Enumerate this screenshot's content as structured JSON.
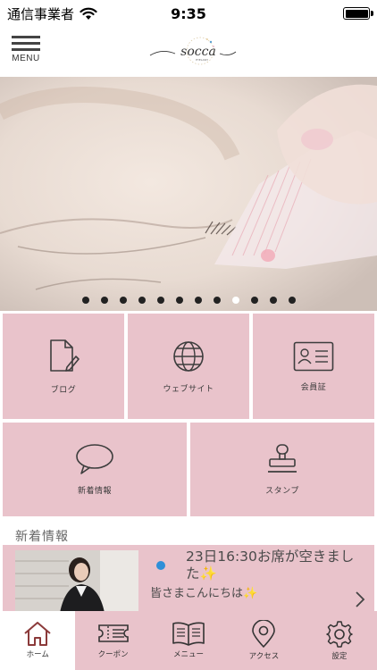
{
  "status_bar": {
    "carrier": "通信事業者",
    "time": "9:35",
    "battery_level": 1.0
  },
  "header": {
    "menu_label": "MENU",
    "logo_text": "socca",
    "logo_subtext": "EYELASH"
  },
  "hero": {
    "slide_count": 12,
    "active_slide": 8
  },
  "tiles": [
    {
      "label": "ブログ",
      "icon": "document-edit-icon"
    },
    {
      "label": "ウェブサイト",
      "icon": "globe-icon"
    },
    {
      "label": "会員証",
      "icon": "member-card-icon"
    },
    {
      "label": "新着情報",
      "icon": "speech-bubble-icon"
    },
    {
      "label": "スタンプ",
      "icon": "stamp-icon"
    }
  ],
  "news": {
    "section_title": "新着情報",
    "headline": "23日16:30お席が空きました✨",
    "body": "皆さまこんにちは✨"
  },
  "tabbar": {
    "items": [
      {
        "label": "ホーム",
        "icon": "home-icon"
      },
      {
        "label": "クーポン",
        "icon": "coupon-icon"
      },
      {
        "label": "メニュー",
        "icon": "book-icon"
      },
      {
        "label": "アクセス",
        "icon": "map-pin-icon"
      },
      {
        "label": "設定",
        "icon": "gear-icon"
      }
    ],
    "active_index": 0
  },
  "colors": {
    "tile_pink": "#e9c3cb",
    "text_dark": "#3a3a3a",
    "notice_dot": "#2f8fd8",
    "home_active": "#8b3a3a"
  }
}
